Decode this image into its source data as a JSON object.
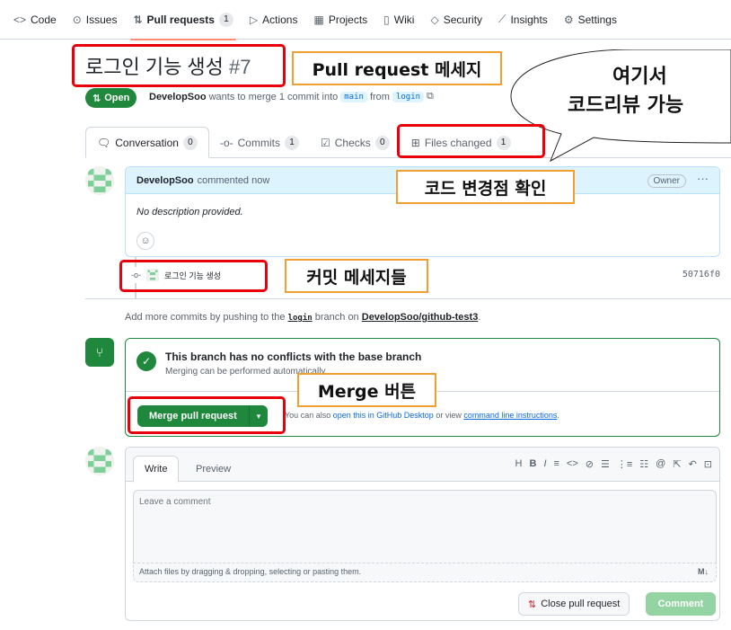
{
  "nav": {
    "items": [
      {
        "icon": "code-icon",
        "glyph": "<>",
        "label": "Code"
      },
      {
        "icon": "issues-icon",
        "glyph": "⊙",
        "label": "Issues"
      },
      {
        "icon": "pull-request-icon",
        "glyph": "⇅",
        "label": "Pull requests",
        "count": "1"
      },
      {
        "icon": "actions-icon",
        "glyph": "▷",
        "label": "Actions"
      },
      {
        "icon": "projects-icon",
        "glyph": "▦",
        "label": "Projects"
      },
      {
        "icon": "wiki-icon",
        "glyph": "▯",
        "label": "Wiki"
      },
      {
        "icon": "security-icon",
        "glyph": "◇",
        "label": "Security"
      },
      {
        "icon": "insights-icon",
        "glyph": "⟋",
        "label": "Insights"
      },
      {
        "icon": "settings-icon",
        "glyph": "⚙",
        "label": "Settings"
      }
    ]
  },
  "pr": {
    "title": "로그인 기능 생성",
    "number": "#7",
    "state": "Open",
    "author": "DevelopSoo",
    "merge_text": "wants to merge 1 commit into",
    "base_branch": "main",
    "from_text": "from",
    "head_branch": "login"
  },
  "tabs": [
    {
      "icon": "conversation-icon",
      "glyph": "🗨",
      "label": "Conversation",
      "count": "0"
    },
    {
      "icon": "commits-icon",
      "glyph": "-o-",
      "label": "Commits",
      "count": "1"
    },
    {
      "icon": "checks-icon",
      "glyph": "☑",
      "label": "Checks",
      "count": "0"
    },
    {
      "icon": "files-icon",
      "glyph": "⊞",
      "label": "Files changed",
      "count": "1"
    }
  ],
  "comment": {
    "author": "DevelopSoo",
    "action": "commented now",
    "badge": "Owner",
    "menu": "···",
    "body": "No description provided.",
    "emoji": "☺"
  },
  "commit": {
    "message": "로그인 기능 생성",
    "sha": "50716f0"
  },
  "hint": {
    "prefix": "Add more commits by pushing to the",
    "branch": "login",
    "mid": "branch on",
    "repo": "DevelopSoo/github-test3",
    "suffix": "."
  },
  "merge": {
    "title": "This branch has no conflicts with the base branch",
    "subtitle": "Merging can be performed automatically.",
    "button": "Merge pull request",
    "dropdown": "▾",
    "alt_prefix": "You can also",
    "alt_link1": "open this in GitHub Desktop",
    "alt_mid": "or view",
    "alt_link2": "command line instructions",
    "alt_suffix": "."
  },
  "composer": {
    "write_tab": "Write",
    "preview_tab": "Preview",
    "toolbar": [
      "H",
      "B",
      "I",
      "≡",
      "<>",
      "⊘",
      "☰",
      "⋮≡",
      "☷",
      "@",
      "⇱",
      "↶",
      "⊡"
    ],
    "placeholder": "Leave a comment",
    "attach_text": "Attach files by dragging & dropping, selecting or pasting them.",
    "md_icon": "M↓",
    "close_button": "Close pull request",
    "comment_button": "Comment"
  },
  "annotations": {
    "pr_message": "Pull request 메세지",
    "code_changes": "코드 변경점 확인",
    "commit_messages": "커밋 메세지들",
    "merge_button": "Merge 버튼",
    "bubble_line1": "여기서",
    "bubble_line2": "코드리뷰 가능"
  },
  "colors": {
    "accent_green": "#1f883d",
    "annotation_red": "#e8000b",
    "annotation_orange": "#f0a030"
  }
}
